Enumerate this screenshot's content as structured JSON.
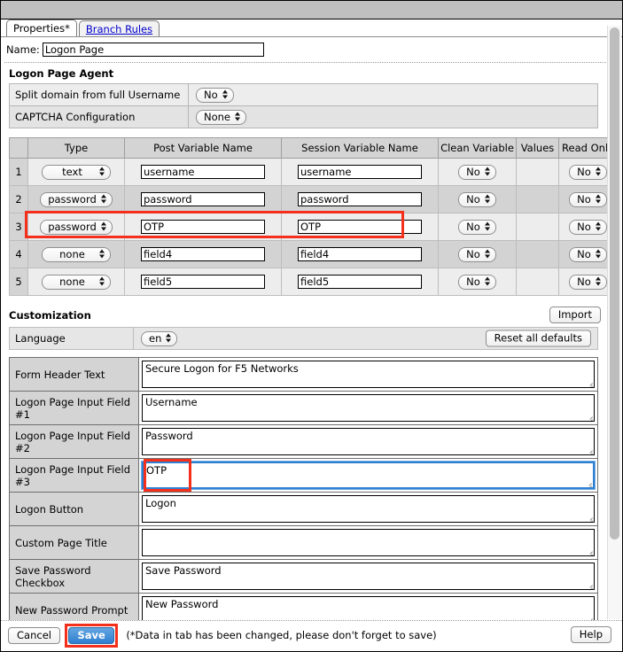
{
  "tabs": [
    {
      "label": "Properties*",
      "active": true
    },
    {
      "label": "Branch Rules",
      "active": false
    }
  ],
  "name_row": {
    "label": "Name:",
    "value": "Logon Page"
  },
  "agent_section": {
    "title": "Logon Page Agent",
    "rows": [
      {
        "label": "Split domain from full Username",
        "value": "No"
      },
      {
        "label": "CAPTCHA Configuration",
        "value": "None"
      }
    ]
  },
  "fields_table": {
    "headers": [
      "",
      "Type",
      "Post Variable Name",
      "Session Variable Name",
      "Clean Variable",
      "Values",
      "Read Only"
    ],
    "rows": [
      {
        "num": "1",
        "type": "text",
        "post": "username",
        "session": "username",
        "clean": "No",
        "values": "",
        "readonly": "No",
        "highlighted": false
      },
      {
        "num": "2",
        "type": "password",
        "post": "password",
        "session": "password",
        "clean": "No",
        "values": "",
        "readonly": "No",
        "highlighted": false
      },
      {
        "num": "3",
        "type": "password",
        "post": "OTP",
        "session": "OTP",
        "clean": "No",
        "values": "",
        "readonly": "No",
        "highlighted": true
      },
      {
        "num": "4",
        "type": "none",
        "post": "field4",
        "session": "field4",
        "clean": "No",
        "values": "",
        "readonly": "No",
        "highlighted": false
      },
      {
        "num": "5",
        "type": "none",
        "post": "field5",
        "session": "field5",
        "clean": "No",
        "values": "",
        "readonly": "No",
        "highlighted": false
      }
    ]
  },
  "customization": {
    "title": "Customization",
    "import_label": "Import",
    "language_label": "Language",
    "language_value": "en",
    "reset_label": "Reset all defaults",
    "rows": [
      {
        "label": "Form Header Text",
        "value": "Secure Logon for F5 Networks",
        "focused": false,
        "highlighted": false
      },
      {
        "label": "Logon Page Input Field #1",
        "value": "Username",
        "focused": false,
        "highlighted": false
      },
      {
        "label": "Logon Page Input Field #2",
        "value": "Password",
        "focused": false,
        "highlighted": false
      },
      {
        "label": "Logon Page Input Field #3",
        "value": "OTP",
        "focused": true,
        "highlighted": true
      },
      {
        "label": "Logon Button",
        "value": "Logon",
        "focused": false,
        "highlighted": false
      },
      {
        "label": "Custom Page Title",
        "value": "",
        "focused": false,
        "highlighted": false
      },
      {
        "label": "Save Password Checkbox",
        "value": "Save Password",
        "focused": false,
        "highlighted": false
      },
      {
        "label": "New Password Prompt",
        "value": "New Password",
        "focused": false,
        "highlighted": false
      }
    ]
  },
  "footer": {
    "cancel_label": "Cancel",
    "save_label": "Save",
    "note": "(*Data in tab has been changed, please don't forget to save)",
    "help_label": "Help"
  },
  "colors": {
    "highlight_red": "#f4301d",
    "focus_blue": "#2f7fd1",
    "link_blue": "#0000cc",
    "header_gray": "#d4d4d4"
  }
}
